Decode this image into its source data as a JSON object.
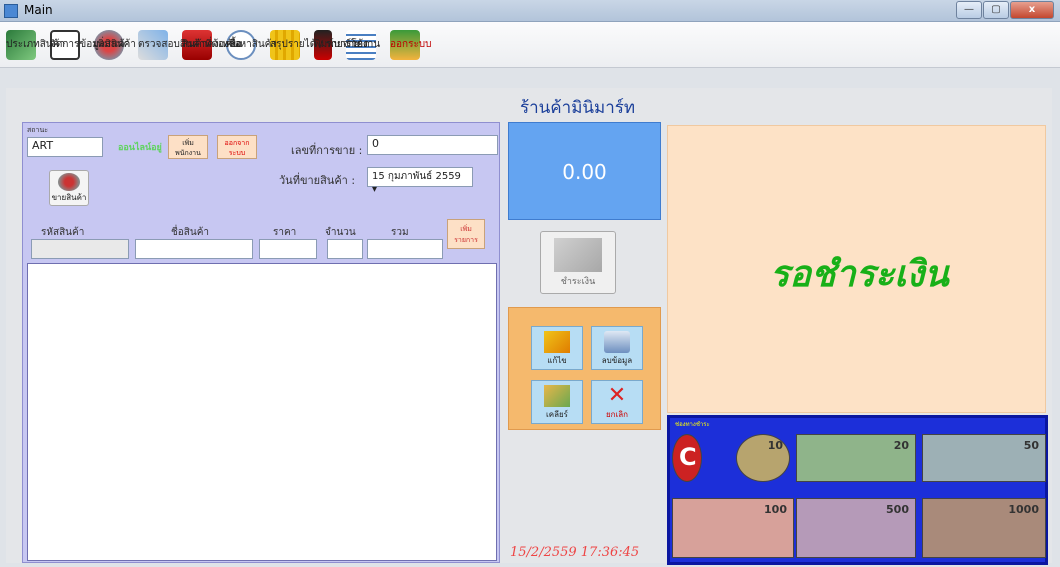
{
  "window": {
    "title": "Main",
    "controls": [
      "—",
      "▢",
      "x"
    ]
  },
  "toolbar": [
    {
      "label": "ประเภทสินค้า",
      "icon": "category-icon",
      "cls": "ic-cat"
    },
    {
      "label": "จัดการข้อมูลสินค้า",
      "icon": "manage-data-icon",
      "cls": "ic-manage"
    },
    {
      "label": "เพิ่มสินค้า",
      "icon": "add-product-icon",
      "cls": "ic-add"
    },
    {
      "label": "ตรวจสอบสินค้าที่ต้องซื้อ",
      "icon": "check-order-icon",
      "cls": "ic-check"
    },
    {
      "label": "สินค้าคงเหลือ",
      "icon": "stock-icon",
      "cls": "ic-stock"
    },
    {
      "label": "ค้นหาสินค้า",
      "icon": "search-icon",
      "cls": "ic-search"
    },
    {
      "label": "สรุปรายได้ / รายจ่าย",
      "icon": "summary-chart-icon",
      "cls": "ic-summary"
    },
    {
      "label": "พิมพ์บาร์โค้ด",
      "icon": "barcode-print-icon",
      "cls": "ic-barcode"
    },
    {
      "label": "รายงาน",
      "icon": "report-icon",
      "cls": "ic-report"
    },
    {
      "label": "ออกระบบ",
      "icon": "logout-icon",
      "cls": "ic-logout",
      "red": true
    }
  ],
  "shop_title": "ร้านค้ามินิมาร์ท",
  "left": {
    "status_label": "สถานะ",
    "user": "ART",
    "online": "ออนไลน์อยู่",
    "add_employee": "เพิ่ม พนักงาน",
    "logout": "ออกจาก ระบบ",
    "sale_no_label": "เลขที่การขาย :",
    "sale_no": "0",
    "date_label": "วันที่ขายสินค้า :",
    "date_value": "15 กุมภาพันธ์ 2559 ▾",
    "sell_label": "ขายสินค้า",
    "columns": [
      "รหัสสินค้า",
      "ชื่อสินค้า",
      "ราคา",
      "จำนวน",
      "รวม"
    ],
    "add_item": "เพิ่ม รายการ"
  },
  "total": "0.00",
  "pay_label": "ชำระเงิน",
  "actions": [
    "แก้ไข",
    "ลบข้อมูล",
    "เคลียร์",
    "ยกเลิก"
  ],
  "datetime": "15/2/2559 17:36:45",
  "wait_text": "รอชำระเงิน",
  "money": {
    "label": "ช่องทางชำระ",
    "notes": [
      "C",
      "10",
      "20",
      "50",
      "100",
      "500",
      "1000"
    ],
    "colors": [
      "#c22",
      "#b7a46e",
      "#8fb48a",
      "#9db0b5",
      "#d7a19a",
      "#b59ab8",
      "#a98a7a"
    ]
  }
}
